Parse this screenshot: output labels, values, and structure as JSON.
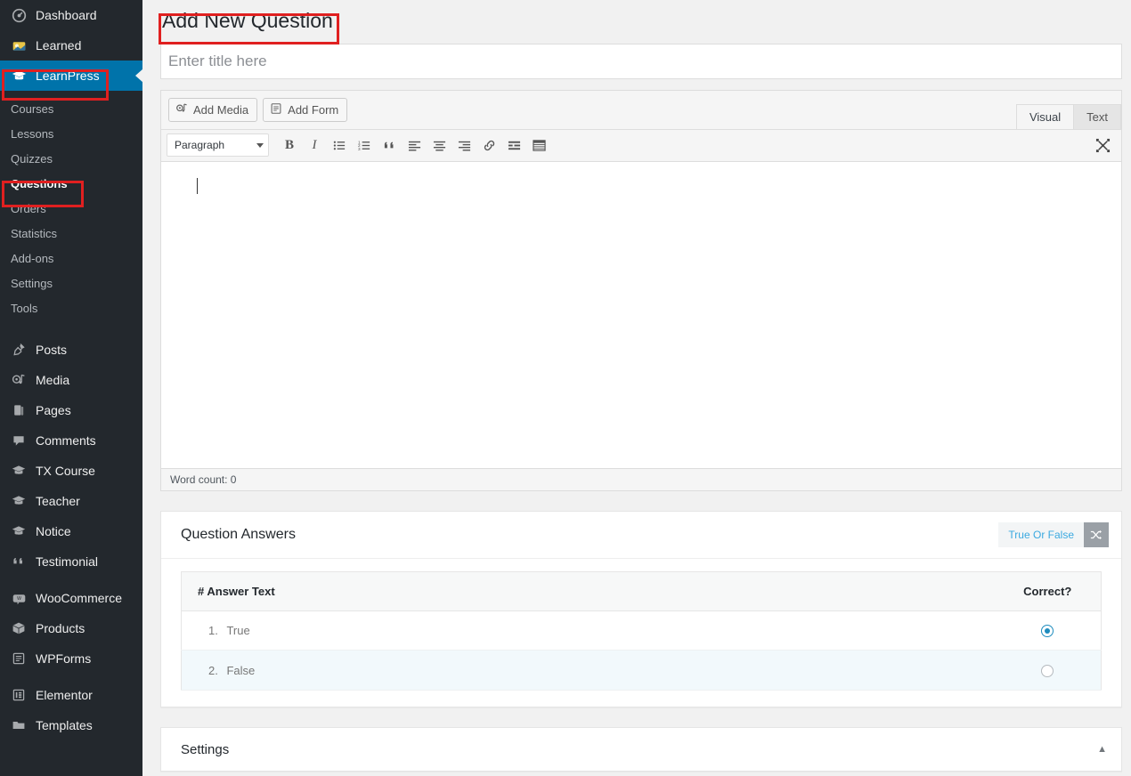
{
  "sidebar": {
    "top_items": [
      {
        "label": "Dashboard",
        "icon": "dashboard-icon"
      },
      {
        "label": "Learned",
        "icon": "learned-icon"
      },
      {
        "label": "LearnPress",
        "icon": "graduation-cap-icon",
        "active": true
      }
    ],
    "sub_items": [
      {
        "label": "Courses"
      },
      {
        "label": "Lessons"
      },
      {
        "label": "Quizzes"
      },
      {
        "label": "Questions",
        "current": true
      },
      {
        "label": "Orders"
      },
      {
        "label": "Statistics"
      },
      {
        "label": "Add-ons"
      },
      {
        "label": "Settings"
      },
      {
        "label": "Tools"
      }
    ],
    "group_two": [
      {
        "label": "Posts",
        "icon": "pin-icon"
      },
      {
        "label": "Media",
        "icon": "media-icon"
      },
      {
        "label": "Pages",
        "icon": "pages-icon"
      },
      {
        "label": "Comments",
        "icon": "comment-icon"
      },
      {
        "label": "TX Course",
        "icon": "graduation-cap-icon"
      },
      {
        "label": "Teacher",
        "icon": "graduation-cap-icon"
      },
      {
        "label": "Notice",
        "icon": "graduation-cap-icon"
      },
      {
        "label": "Testimonial",
        "icon": "quote-icon"
      }
    ],
    "group_three": [
      {
        "label": "WooCommerce",
        "icon": "woocommerce-icon"
      },
      {
        "label": "Products",
        "icon": "products-icon"
      },
      {
        "label": "WPForms",
        "icon": "wpforms-icon"
      }
    ],
    "group_four": [
      {
        "label": "Elementor",
        "icon": "elementor-icon"
      },
      {
        "label": "Templates",
        "icon": "folder-icon"
      }
    ]
  },
  "page": {
    "title": "Add New Question"
  },
  "title_field": {
    "placeholder": "Enter title here",
    "value": ""
  },
  "editor": {
    "add_media_label": "Add Media",
    "add_form_label": "Add Form",
    "tabs": [
      {
        "label": "Visual",
        "active": true
      },
      {
        "label": "Text",
        "active": false
      }
    ],
    "format_select": "Paragraph",
    "toolbar_buttons": [
      {
        "name": "bold-icon",
        "glyph": "B"
      },
      {
        "name": "italic-icon",
        "glyph": "I"
      },
      {
        "name": "bulleted-list-icon",
        "glyph": ""
      },
      {
        "name": "numbered-list-icon",
        "glyph": ""
      },
      {
        "name": "blockquote-icon",
        "glyph": "“"
      },
      {
        "name": "align-left-icon",
        "glyph": ""
      },
      {
        "name": "align-center-icon",
        "glyph": ""
      },
      {
        "name": "align-right-icon",
        "glyph": ""
      },
      {
        "name": "link-icon",
        "glyph": ""
      },
      {
        "name": "read-more-icon",
        "glyph": ""
      },
      {
        "name": "toolbar-toggle-icon",
        "glyph": ""
      }
    ],
    "fullscreen_label": "",
    "content": "",
    "word_count": "Word count: 0"
  },
  "question_answers": {
    "title": "Question Answers",
    "question_type": "True Or False",
    "shuffle_label": "",
    "columns": [
      "# Answer Text",
      "Correct?"
    ],
    "rows": [
      {
        "index": "1.",
        "text": "True",
        "correct": true
      },
      {
        "index": "2.",
        "text": "False",
        "correct": false
      }
    ]
  },
  "settings": {
    "title": "Settings",
    "toggle": "▲"
  },
  "colors": {
    "sidebar_bg": "#23282d",
    "active_blue": "#0073aa",
    "annotation_red": "#e02020",
    "link_blue": "#3ba9e0",
    "row_alt": "#f2f9fc"
  }
}
